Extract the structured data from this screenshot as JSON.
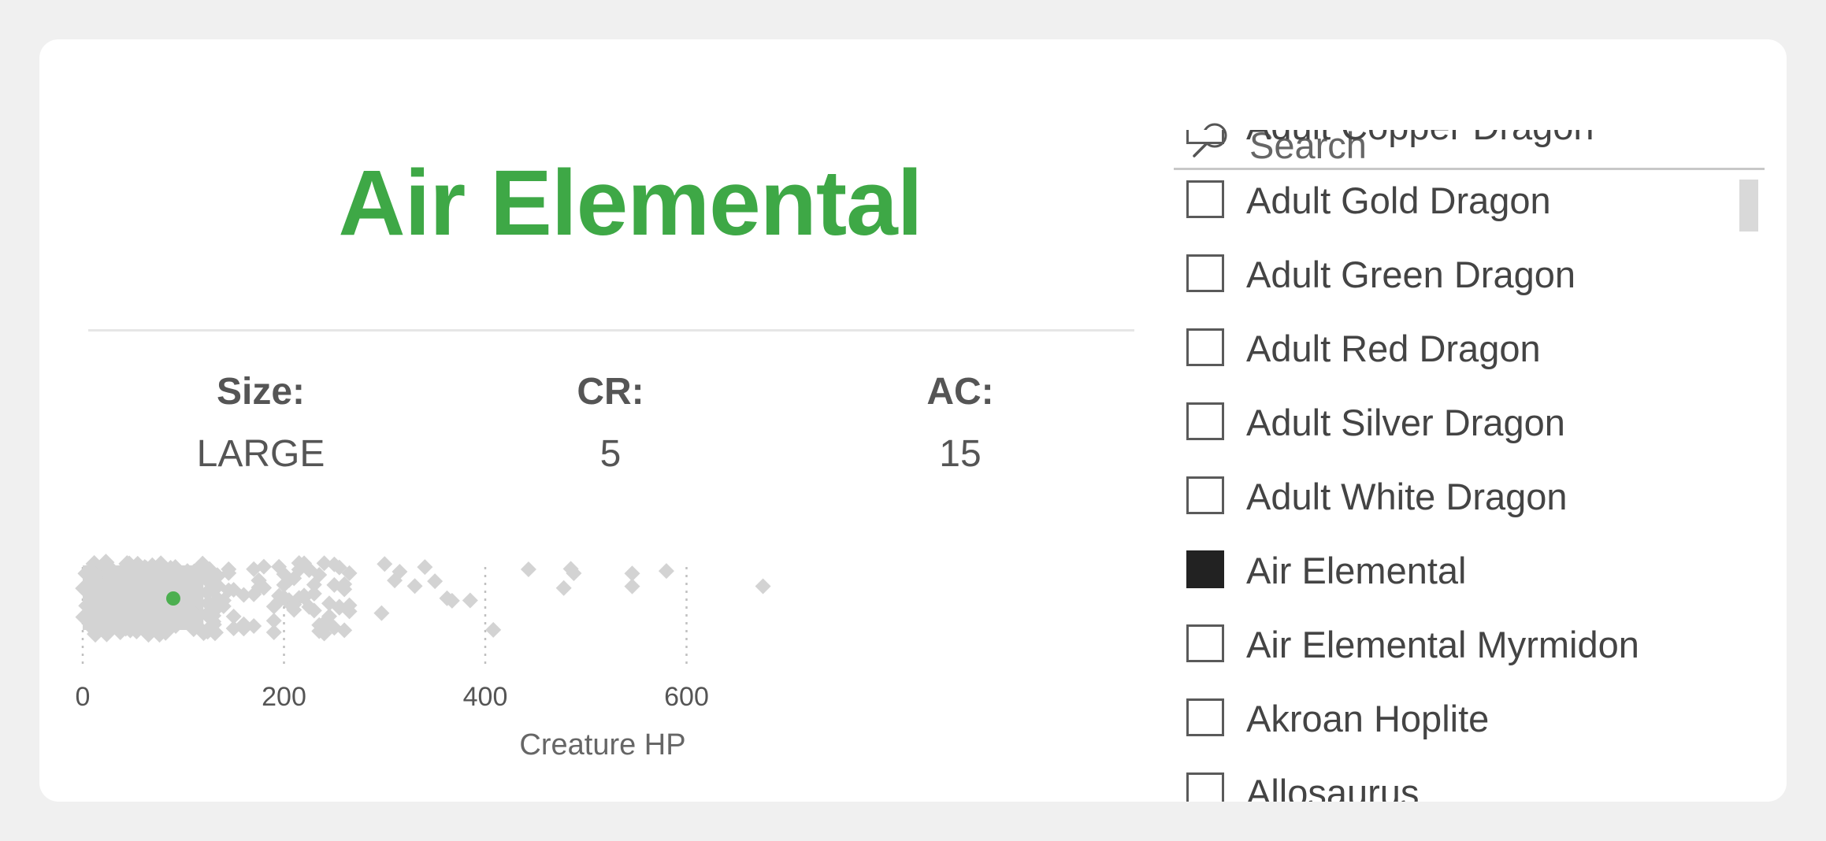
{
  "creature": {
    "name": "Air Elemental",
    "size_label": "Size:",
    "size_value": "LARGE",
    "cr_label": "CR:",
    "cr_value": "5",
    "ac_label": "AC:",
    "ac_value": "15"
  },
  "colors": {
    "accent": "#3ea846",
    "point": "#d3d3d3",
    "selected_point": "#4caf50"
  },
  "chart_data": {
    "type": "scatter",
    "xlabel": "Creature HP",
    "x_ticks": [
      0,
      200,
      400,
      600
    ],
    "xlim": [
      0,
      700
    ],
    "grid": "vertical dotted",
    "selected": {
      "name": "Air Elemental",
      "hp": 90
    },
    "points": [
      {
        "hp": 125
      },
      {
        "hp": 130
      },
      {
        "hp": 140
      },
      {
        "hp": 145
      },
      {
        "hp": 150
      },
      {
        "hp": 160
      },
      {
        "hp": 170
      },
      {
        "hp": 175
      },
      {
        "hp": 180
      },
      {
        "hp": 190
      },
      {
        "hp": 195
      },
      {
        "hp": 200
      },
      {
        "hp": 205
      },
      {
        "hp": 210
      },
      {
        "hp": 215
      },
      {
        "hp": 220
      },
      {
        "hp": 225
      },
      {
        "hp": 230
      },
      {
        "hp": 235
      },
      {
        "hp": 240
      },
      {
        "hp": 245
      },
      {
        "hp": 250
      },
      {
        "hp": 255
      },
      {
        "hp": 260
      },
      {
        "hp": 265
      },
      {
        "hp": 297
      },
      {
        "hp": 300
      },
      {
        "hp": 310
      },
      {
        "hp": 315
      },
      {
        "hp": 330
      },
      {
        "hp": 340
      },
      {
        "hp": 350
      },
      {
        "hp": 362
      },
      {
        "hp": 367
      },
      {
        "hp": 385
      },
      {
        "hp": 408
      },
      {
        "hp": 443
      },
      {
        "hp": 478
      },
      {
        "hp": 485
      },
      {
        "hp": 488
      },
      {
        "hp": 546
      },
      {
        "hp": 546
      },
      {
        "hp": 580
      },
      {
        "hp": 676
      }
    ],
    "dense_range": [
      0,
      120
    ]
  },
  "slicer": {
    "search_placeholder": "Search",
    "items": [
      {
        "label": "Adult Copper Dragon",
        "checked": false
      },
      {
        "label": "Adult Gold Dragon",
        "checked": false
      },
      {
        "label": "Adult Green Dragon",
        "checked": false
      },
      {
        "label": "Adult Red Dragon",
        "checked": false
      },
      {
        "label": "Adult Silver Dragon",
        "checked": false
      },
      {
        "label": "Adult White Dragon",
        "checked": false
      },
      {
        "label": "Air Elemental",
        "checked": true
      },
      {
        "label": "Air Elemental Myrmidon",
        "checked": false
      },
      {
        "label": "Akroan Hoplite",
        "checked": false
      },
      {
        "label": "Allosaurus",
        "checked": false
      }
    ]
  }
}
